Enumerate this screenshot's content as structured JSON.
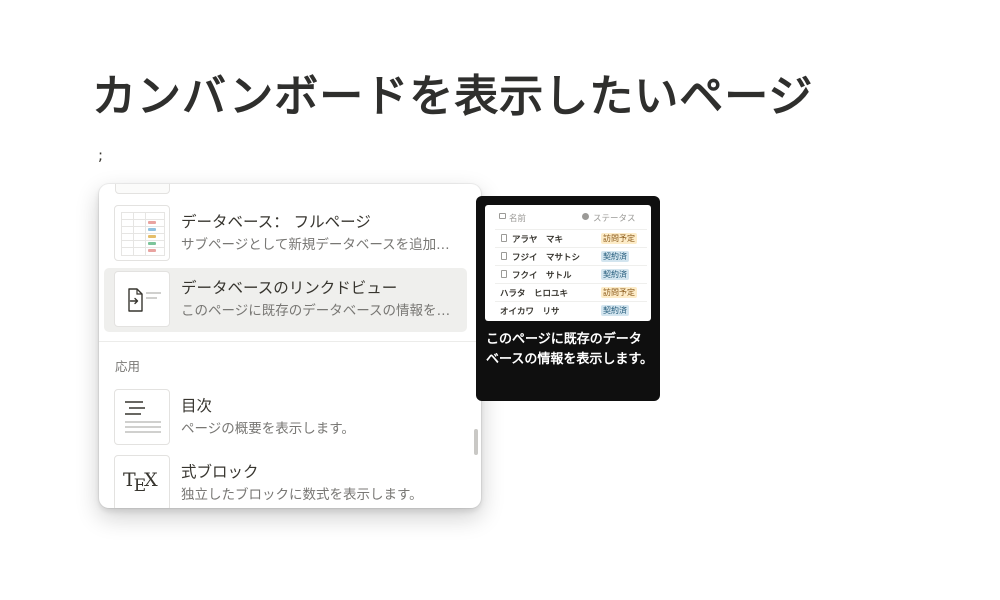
{
  "page": {
    "title": "カンバンボードを表示したいページ",
    "typed_text": ";"
  },
  "menu": {
    "items": [
      {
        "title": "データベース： フルページ",
        "description": "サブページとして新規データベースを追加します。",
        "icon": "database-table-icon"
      },
      {
        "title": "データベースのリンクドビュー",
        "description": "このページに既存のデータベースの情報を表示します。",
        "icon": "linked-view-icon",
        "selected": true
      },
      {
        "title": "目次",
        "description": "ページの概要を表示します。",
        "icon": "toc-icon"
      },
      {
        "title": "式ブロック",
        "description": "独立したブロックに数式を表示します。",
        "icon": "tex-icon"
      }
    ],
    "section_label": "応用",
    "tex_label": {
      "t": "T",
      "e": "E",
      "x": "X"
    }
  },
  "preview": {
    "header": {
      "name": "名前",
      "status": "ステータス"
    },
    "rows": [
      {
        "name": "アラヤ　マキ",
        "status": "訪問予定",
        "status_color": "#fdecc8",
        "status_text_color": "#8b5a1b"
      },
      {
        "name": "フジイ　マサトシ",
        "status": "契約済",
        "status_color": "#d3e5ef",
        "status_text_color": "#1f5777"
      },
      {
        "name": "フクイ　サトル",
        "status": "契約済",
        "status_color": "#d3e5ef",
        "status_text_color": "#1f5777"
      },
      {
        "name": "ハラタ　ヒロユキ",
        "status": "訪問予定",
        "status_color": "#fdecc8",
        "status_text_color": "#8b5a1b"
      },
      {
        "name": "オイカワ　リサ",
        "status": "契約済",
        "status_color": "#d3e5ef",
        "status_text_color": "#1f5777"
      }
    ],
    "description": "このページに既存のデータベースの情報を表示します。"
  },
  "colors": {
    "selected_bg": "#efefed",
    "tooltip_bg": "#0f0f0f",
    "title_text": "#2f2f2d"
  }
}
